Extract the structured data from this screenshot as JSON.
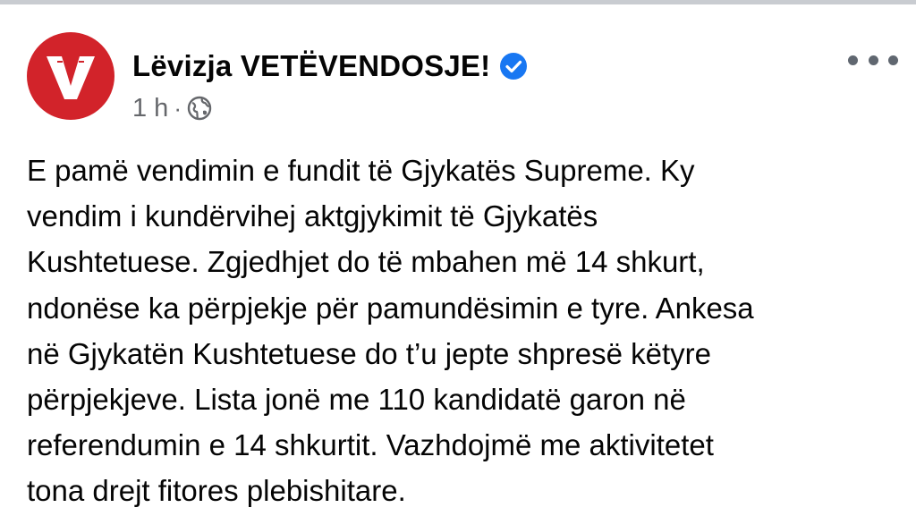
{
  "post": {
    "author": {
      "name": "Lëvizja VETËVENDOSJE!",
      "avatar_letter": "V",
      "avatar_color": "#d2232a",
      "verified": true,
      "verified_color": "#1877f2"
    },
    "meta": {
      "time": "1 h",
      "separator": "·",
      "audience_icon": "globe-icon"
    },
    "more_icon": "more-options-icon",
    "text_lines": [
      "E pamë vendimin e fundit të Gjykatës Supreme. Ky",
      "vendim i kundërvihej aktgjykimit të Gjykatës",
      "Kushtetuese. Zgjedhjet do të mbahen më 14 shkurt,",
      "ndonëse ka përpjekje për pamundësimin e tyre. Ankesa",
      "në Gjykatën Kushtetuese do t’u jepte shpresë këtyre",
      "përpjekjeve. Lista jonë me 110 kandidatë garon në",
      "referendumin e 14 shkurtit. Vazhdojmë me aktivitetet",
      "tona drejt fitores plebishitare."
    ]
  }
}
